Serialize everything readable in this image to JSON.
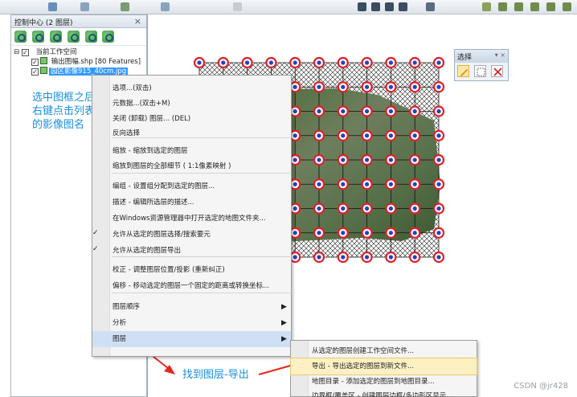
{
  "panel": {
    "title": "控制中心 (2 图层)",
    "close": "×",
    "tree": [
      {
        "expander": "⊟",
        "checked": true,
        "label": "当前工作空间",
        "selected": false
      },
      {
        "checked": true,
        "label": "输出图幅.shp [80 Features]",
        "selected": false
      },
      {
        "checked": true,
        "label": "园区影像915_40cm.jpg",
        "selected": true
      }
    ]
  },
  "selection_toolbar": {
    "title": "选择",
    "controls": "▾ ×"
  },
  "context_menu": {
    "items": [
      {
        "label": "选项...(双击)"
      },
      {
        "label": "元数据...(双击+M)"
      },
      {
        "label": "关闭 (卸载) 图层... (DEL)"
      },
      {
        "label": "反向选择"
      },
      {
        "label": "缩放 - 缩放到选定的图层"
      },
      {
        "label": "缩放到图层的全部细节 ( 1:1像素映射 )"
      },
      {
        "label": "编组 - 设置组分配到选定的图层..."
      },
      {
        "label": "描述 - 编辑所选层的描述..."
      },
      {
        "label": "在Windows资源管理器中打开选定的地图文件夹..."
      },
      {
        "label": "允许从选定的图层选择/搜索要元",
        "checked": true
      },
      {
        "label": "允许从选定的图层导出",
        "checked": true
      },
      {
        "label": "校正 - 调整图层位置/投影 (重新纠正)"
      },
      {
        "label": "偏移 - 移动选定的图层一个固定的距离或转换坐标..."
      },
      {
        "label": "图层顺序",
        "submenu": true
      },
      {
        "label": "分析",
        "submenu": true
      },
      {
        "label": "图层",
        "submenu": true,
        "highlighted": true
      }
    ],
    "check_glyph": "✓",
    "arrow_glyph": "▶"
  },
  "submenu": {
    "items": [
      {
        "label": "从选定的图层创建工作空间文件..."
      },
      {
        "label": "导出 - 导出选定的图层到新文件...",
        "highlighted": true
      },
      {
        "label": "地图目录 - 添加选定的图层到地图目录..."
      },
      {
        "label": "边界框/覆盖区 - 创建图层边框/多边形区显示..."
      }
    ]
  },
  "annotations": {
    "left_note": [
      "选中图框之后,",
      "右键点击列表",
      "的影像图名"
    ],
    "bottom_note": "找到图层-导出",
    "accent_color": "#1a8fe0",
    "arrow_color": "#e8261c"
  },
  "watermark": "CSDN @jr428",
  "colors": {
    "highlight_blue": "#3399ff",
    "grid_point_red": "#e0202a",
    "grid_point_blue": "#2340c8"
  }
}
